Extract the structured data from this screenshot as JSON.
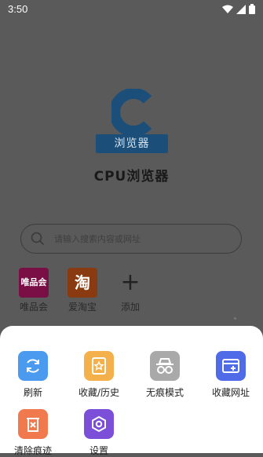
{
  "status_bar": {
    "time": "3:50",
    "icons": [
      "wifi-icon",
      "signal-icon",
      "battery-icon"
    ]
  },
  "app": {
    "logo_tag_text": "浏览器",
    "name": "CPU浏览器"
  },
  "search": {
    "placeholder": "请输入搜索内容或网址"
  },
  "shortcuts": [
    {
      "tile_text": "唯品会",
      "label": "唯品会",
      "color": "#7a0f45"
    },
    {
      "tile_text": "淘",
      "label": "爱淘宝",
      "color": "#8a3a10"
    },
    {
      "tile_text": "+",
      "label": "添加",
      "color": "transparent"
    }
  ],
  "menu": [
    {
      "label": "刷新",
      "icon": "refresh-icon",
      "color": "#4a9af0"
    },
    {
      "label": "收藏/历史",
      "icon": "star-document-icon",
      "color": "#f4b04a"
    },
    {
      "label": "无痕模式",
      "icon": "incognito-icon",
      "color": "#a9a9a9"
    },
    {
      "label": "收藏网址",
      "icon": "bookmark-add-icon",
      "color": "#4f6be8"
    },
    {
      "label": "清除痕迹",
      "icon": "trash-icon",
      "color": "#f07a4e"
    },
    {
      "label": "设置",
      "icon": "settings-icon",
      "color": "#7c4fd8"
    }
  ]
}
